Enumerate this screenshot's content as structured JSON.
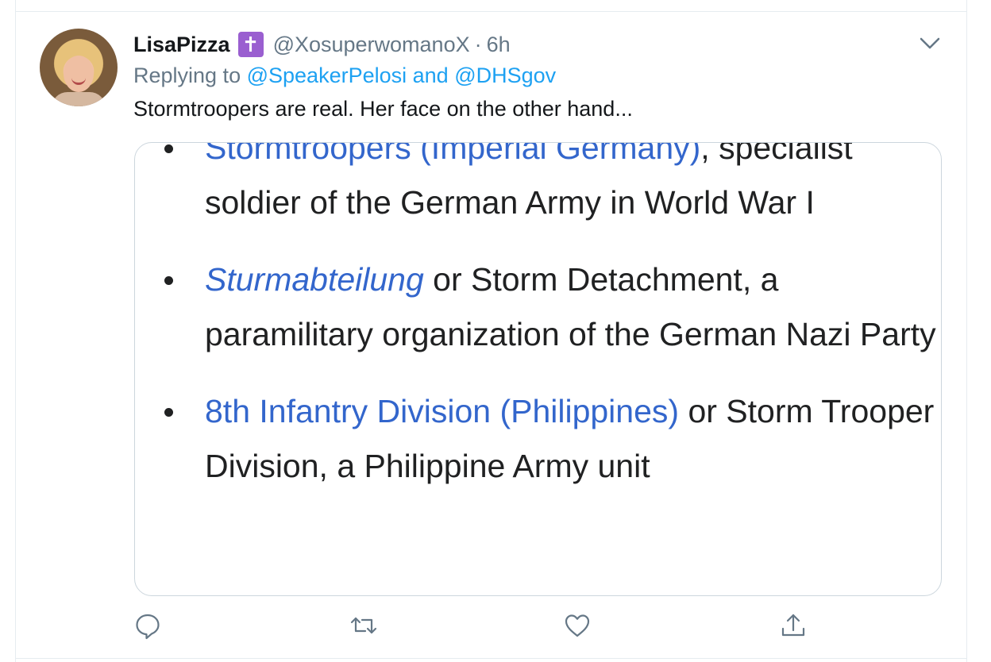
{
  "tweet": {
    "display_name": "LisaPizza",
    "badge_glyph": "✝",
    "handle": "@XosuperwomanoX",
    "separator": "·",
    "time": "6h",
    "reply_prefix": "Replying to",
    "reply_user1": "@SpeakerPelosi",
    "reply_and": "and",
    "reply_user2": "@DHSgov",
    "text": "Stormtroopers are real. Her face on the other hand..."
  },
  "card": {
    "items": [
      {
        "link": "Stormtroopers (Imperial Germany)",
        "rest": ", specialist soldier of the German Army in World War I"
      },
      {
        "link": "Sturmabteilung",
        "rest": " or Storm Detachment, a paramilitary organization of the German Nazi Party"
      },
      {
        "link": "8th Infantry Division (Philippines)",
        "rest": " or Storm Trooper Division, a Philippine Army unit"
      }
    ]
  },
  "icons": {
    "menu": "chevron-down-icon",
    "reply": "reply-icon",
    "retweet": "retweet-icon",
    "like": "like-icon",
    "share": "share-icon"
  },
  "colors": {
    "link": "#1da1f2",
    "muted": "#657786",
    "wiki_link": "#3366cc",
    "badge": "#9a5fd0"
  }
}
